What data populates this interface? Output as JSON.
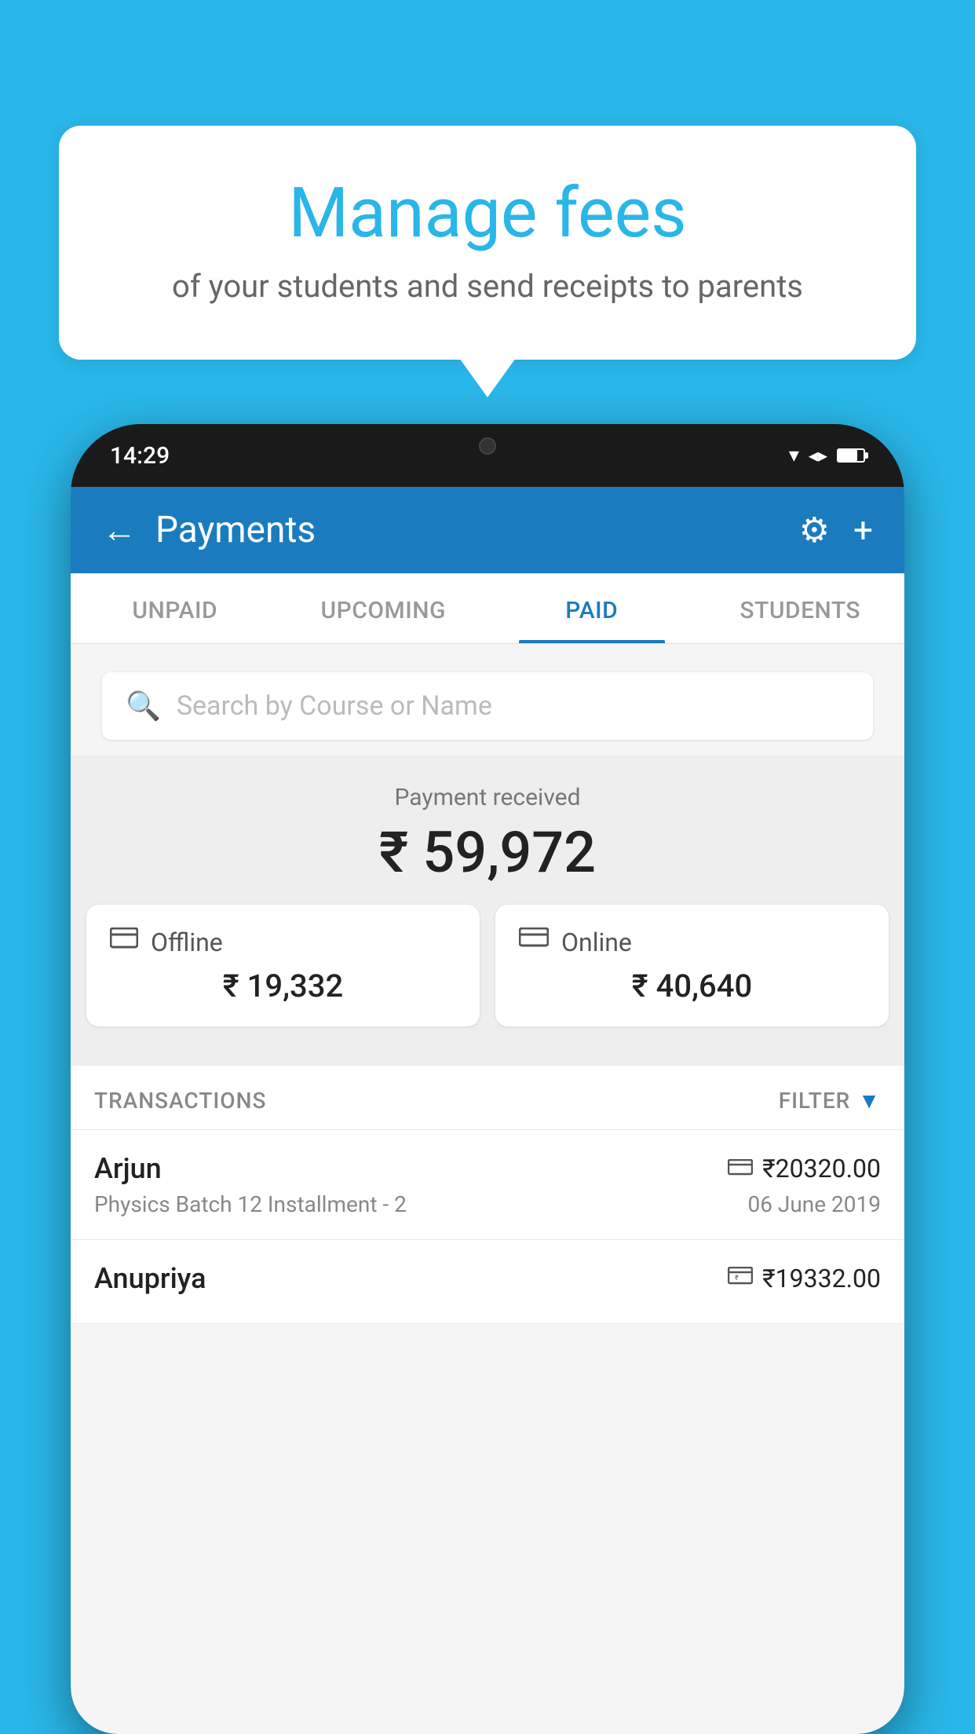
{
  "background_color": "#29b6e8",
  "speech_bubble": {
    "title": "Manage fees",
    "subtitle": "of your students and send receipts to parents"
  },
  "status_bar": {
    "time": "14:29"
  },
  "header": {
    "title": "Payments",
    "back_label": "←",
    "gear_label": "⚙",
    "plus_label": "+"
  },
  "tabs": [
    {
      "label": "UNPAID",
      "active": false
    },
    {
      "label": "UPCOMING",
      "active": false
    },
    {
      "label": "PAID",
      "active": true
    },
    {
      "label": "STUDENTS",
      "active": false
    }
  ],
  "search": {
    "placeholder": "Search by Course or Name"
  },
  "payment_received": {
    "label": "Payment received",
    "amount": "₹ 59,972"
  },
  "payment_cards": [
    {
      "icon": "offline",
      "label": "Offline",
      "amount": "₹ 19,332"
    },
    {
      "icon": "online",
      "label": "Online",
      "amount": "₹ 40,640"
    }
  ],
  "transactions_label": "TRANSACTIONS",
  "filter_label": "FILTER",
  "transactions": [
    {
      "name": "Arjun",
      "course": "Physics Batch 12 Installment - 2",
      "amount": "₹20320.00",
      "date": "06 June 2019",
      "icon": "online"
    },
    {
      "name": "Anupriya",
      "course": "",
      "amount": "₹19332.00",
      "date": "",
      "icon": "offline"
    }
  ]
}
